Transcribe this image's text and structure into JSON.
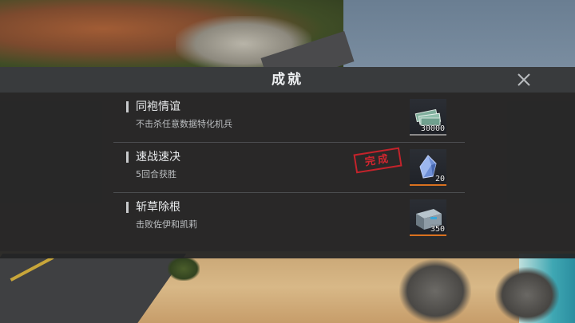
{
  "panel": {
    "title": "成就",
    "close_icon": "close-icon"
  },
  "achievements": [
    {
      "title": "同袍情谊",
      "description": "不击杀任意数据特化机兵",
      "completed": false,
      "reward": {
        "icon": "cash-stack-icon",
        "quantity": "30000",
        "rarity_color": "#8a8a8a"
      }
    },
    {
      "title": "速战速决",
      "description": "5回合获胜",
      "completed": true,
      "stamp": "完成",
      "reward": {
        "icon": "crystal-icon",
        "quantity": "20",
        "rarity_color": "#d9711f"
      }
    },
    {
      "title": "斩草除根",
      "description": "击败佐伊和凯莉",
      "completed": false,
      "reward": {
        "icon": "supply-crate-icon",
        "quantity": "350",
        "rarity_color": "#d9711f"
      }
    }
  ],
  "colors": {
    "stamp": "#c4232b",
    "reward_rare": "#d9711f"
  }
}
